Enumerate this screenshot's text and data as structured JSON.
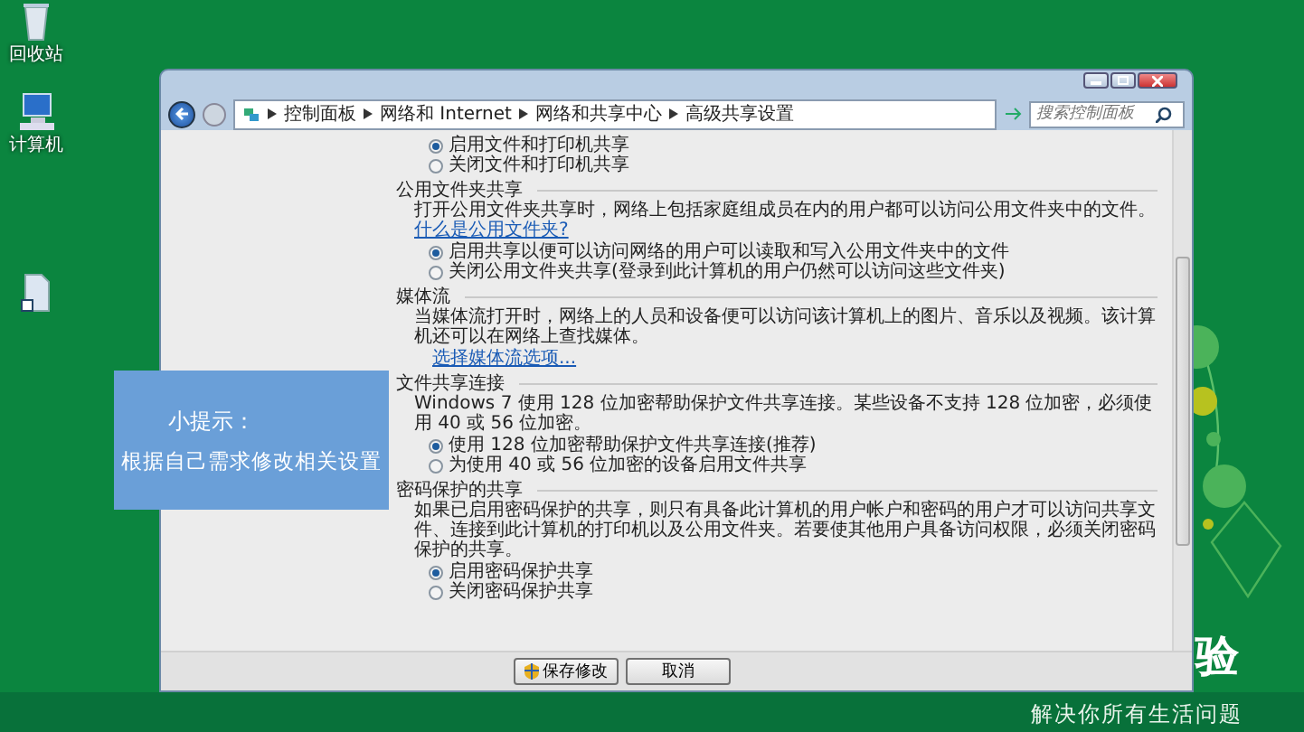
{
  "desktop_icons": [
    {
      "kind": "recycle",
      "label": "回收站"
    },
    {
      "kind": "computer",
      "label": "计算机"
    },
    {
      "kind": "file"
    }
  ],
  "window": {
    "breadcrumb": [
      "控制面板",
      "网络和 Internet",
      "网络和共享中心",
      "高级共享设置"
    ],
    "search": {
      "placeholder": "搜索控制面板"
    },
    "sections": [
      {
        "options": [
          {
            "label": "启用文件和打印机共享",
            "selected": true
          },
          {
            "label": "关闭文件和打印机共享",
            "selected": false
          }
        ]
      },
      {
        "heading": "公用文件夹共享",
        "description": "打开公用文件夹共享时，网络上包括家庭组成员在内的用户都可以访问公用文件夹中的文件。",
        "link": "什么是公用文件夹?",
        "options": [
          {
            "label": "启用共享以便可以访问网络的用户可以读取和写入公用文件夹中的文件",
            "selected": true
          },
          {
            "label": "关闭公用文件夹共享(登录到此计算机的用户仍然可以访问这些文件夹)",
            "selected": false
          }
        ]
      },
      {
        "heading": "媒体流",
        "description": "当媒体流打开时，网络上的人员和设备便可以访问该计算机上的图片、音乐以及视频。该计算机还可以在网络上查找媒体。",
        "action_link": "选择媒体流选项..."
      },
      {
        "heading": "文件共享连接",
        "description": "Windows 7 使用 128 位加密帮助保护文件共享连接。某些设备不支持 128 位加密，必须使用 40 或 56 位加密。",
        "options": [
          {
            "label": "使用 128 位加密帮助保护文件共享连接(推荐)",
            "selected": true
          },
          {
            "label": "为使用 40 或 56 位加密的设备启用文件共享",
            "selected": false
          }
        ]
      },
      {
        "heading": "密码保护的共享",
        "description": "如果已启用密码保护的共享，则只有具备此计算机的用户帐户和密码的用户才可以访问共享文件、连接到此计算机的打印机以及公用文件夹。若要使其他用户具备访问权限，必须关闭密码保护的共享。",
        "options": [
          {
            "label": "启用密码保护共享",
            "selected": true
          },
          {
            "label": "关闭密码保护共享",
            "selected": false
          }
        ]
      }
    ],
    "buttons": [
      {
        "kind": "shield",
        "label": "保存修改"
      },
      {
        "kind": "plain",
        "label": "取消"
      }
    ]
  },
  "tip": {
    "title": "小提示：",
    "text": "根据自己需求修改相关设置"
  },
  "wallpaper": {
    "brand_fragment": "验",
    "slogan": "解决你所有生活问题"
  }
}
